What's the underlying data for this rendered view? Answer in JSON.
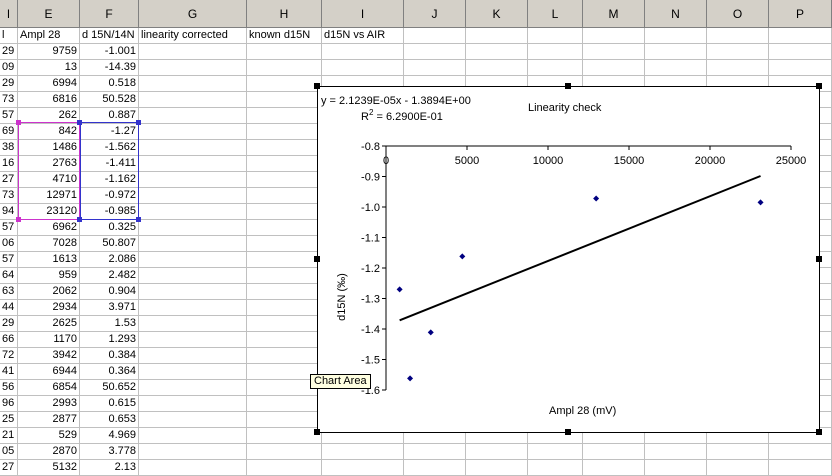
{
  "columns": [
    {
      "id": "row-stub",
      "label": "l"
    },
    {
      "id": "E",
      "label": "E"
    },
    {
      "id": "F",
      "label": "F"
    },
    {
      "id": "G",
      "label": "G"
    },
    {
      "id": "H",
      "label": "H"
    },
    {
      "id": "I",
      "label": "I"
    },
    {
      "id": "J",
      "label": "J"
    },
    {
      "id": "K",
      "label": "K"
    },
    {
      "id": "L",
      "label": "L"
    },
    {
      "id": "M",
      "label": "M"
    },
    {
      "id": "N",
      "label": "N"
    },
    {
      "id": "O",
      "label": "O"
    },
    {
      "id": "P",
      "label": "P"
    }
  ],
  "header_row": {
    "D": "l",
    "E": "Ampl  28",
    "F": "d 15N/14N",
    "G": "linearity corrected",
    "H": "known d15N",
    "I": "d15N vs AIR"
  },
  "rows": [
    {
      "D": "29",
      "E": "9759",
      "F": "-1.001"
    },
    {
      "D": "09",
      "E": "13",
      "F": "-14.39"
    },
    {
      "D": "29",
      "E": "6994",
      "F": "0.518"
    },
    {
      "D": "73",
      "E": "6816",
      "F": "50.528"
    },
    {
      "D": "57",
      "E": "262",
      "F": "0.887"
    },
    {
      "D": "69",
      "E": "842",
      "F": "-1.27"
    },
    {
      "D": "38",
      "E": "1486",
      "F": "-1.562"
    },
    {
      "D": "16",
      "E": "2763",
      "F": "-1.411"
    },
    {
      "D": "27",
      "E": "4710",
      "F": "-1.162"
    },
    {
      "D": "73",
      "E": "12971",
      "F": "-0.972"
    },
    {
      "D": "94",
      "E": "23120",
      "F": "-0.985"
    },
    {
      "D": "57",
      "E": "6962",
      "F": "0.325"
    },
    {
      "D": "06",
      "E": "7028",
      "F": "50.807"
    },
    {
      "D": "57",
      "E": "1613",
      "F": "2.086"
    },
    {
      "D": "64",
      "E": "959",
      "F": "2.482"
    },
    {
      "D": "63",
      "E": "2062",
      "F": "0.904"
    },
    {
      "D": "44",
      "E": "2934",
      "F": "3.971"
    },
    {
      "D": "29",
      "E": "2625",
      "F": "1.53"
    },
    {
      "D": "66",
      "E": "1170",
      "F": "1.293"
    },
    {
      "D": "72",
      "E": "3942",
      "F": "0.384"
    },
    {
      "D": "41",
      "E": "6944",
      "F": "0.364"
    },
    {
      "D": "56",
      "E": "6854",
      "F": "50.652"
    },
    {
      "D": "96",
      "E": "2993",
      "F": "0.615"
    },
    {
      "D": "25",
      "E": "2877",
      "F": "0.653"
    },
    {
      "D": "21",
      "E": "529",
      "F": "4.969"
    },
    {
      "D": "05",
      "E": "2870",
      "F": "3.778"
    },
    {
      "D": "27",
      "E": "5132",
      "F": "2.13"
    }
  ],
  "chart_data": {
    "type": "scatter",
    "title": "Linearity check",
    "equation": "y = 2.1239E-05x - 1.3894E+00",
    "r2_prefix": "R",
    "r2_sup": "2",
    "r2_suffix": " = 6.2900E-01",
    "xlabel": "Ampl 28 (mV)",
    "ylabel": "d15N (‰)",
    "xlim": [
      0,
      25000
    ],
    "ylim": [
      -1.6,
      -0.8
    ],
    "x_ticks": [
      0,
      5000,
      10000,
      15000,
      20000,
      25000
    ],
    "x_tick_labels": [
      "0",
      "5000",
      "10000",
      "15000",
      "20000",
      "25000"
    ],
    "y_ticks": [
      -0.8,
      -0.9,
      -1.0,
      -1.1,
      -1.2,
      -1.3,
      -1.4,
      -1.5,
      -1.6
    ],
    "y_tick_labels": [
      "-0.8",
      "-0.9",
      "-1.0",
      "-1.1",
      "-1.2",
      "-1.3",
      "-1.4",
      "-1.5",
      "-1.6"
    ],
    "points": [
      {
        "x": 842,
        "y": -1.27
      },
      {
        "x": 1486,
        "y": -1.562
      },
      {
        "x": 2763,
        "y": -1.411
      },
      {
        "x": 4710,
        "y": -1.162
      },
      {
        "x": 12971,
        "y": -0.972
      },
      {
        "x": 23120,
        "y": -0.985
      }
    ],
    "trendline": {
      "slope": 2.1239e-05,
      "intercept": -1.3894,
      "x_range": [
        842,
        23120
      ]
    },
    "grid": false,
    "legend": "none",
    "colors": {
      "marker": "#000080",
      "trendline": "#000000"
    }
  },
  "tooltip": "Chart Area",
  "colors": {
    "header_bg": "#d4d0c8",
    "grid_line": "#c0c0c0",
    "selection_magenta": "#cc33cc",
    "selection_blue": "#3333cc"
  }
}
